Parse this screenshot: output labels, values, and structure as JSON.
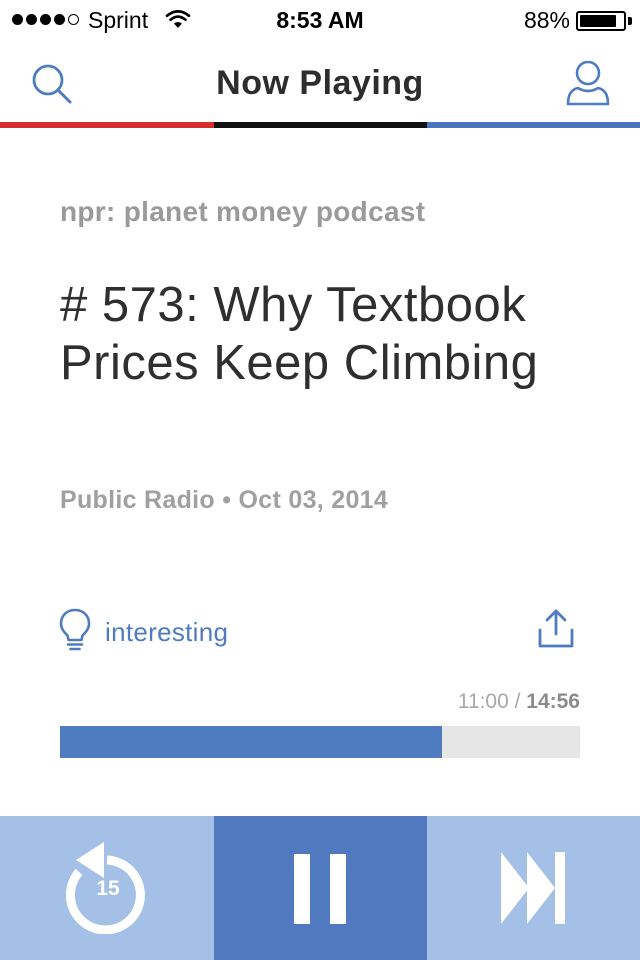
{
  "status_bar": {
    "carrier": "Sprint",
    "time": "8:53 AM",
    "battery_pct": "88%",
    "battery_level": 0.88,
    "signal_bars_filled": 4,
    "signal_bars_total": 5
  },
  "nav": {
    "title": "Now Playing",
    "left_icon": "search-icon",
    "right_icon": "user-icon",
    "stripe_colors": [
      "#d62d2d",
      "#111111",
      "#4a74bd"
    ]
  },
  "episode": {
    "program": "npr: planet money podcast",
    "title": "# 573: Why Textbook Prices Keep Climbing",
    "meta": "Public Radio • Oct 03, 2014"
  },
  "actions": {
    "tag_label": "interesting",
    "tag_icon": "lightbulb-icon",
    "share_icon": "share-icon"
  },
  "playback": {
    "elapsed": "11:00",
    "separator": " / ",
    "total": "14:56",
    "progress_fraction": 0.735,
    "rewind_seconds": "15",
    "accent_color": "#4f7cc0"
  },
  "controls": {
    "rewind_icon": "rewind-15-icon",
    "pause_icon": "pause-icon",
    "skip_icon": "skip-forward-icon"
  }
}
